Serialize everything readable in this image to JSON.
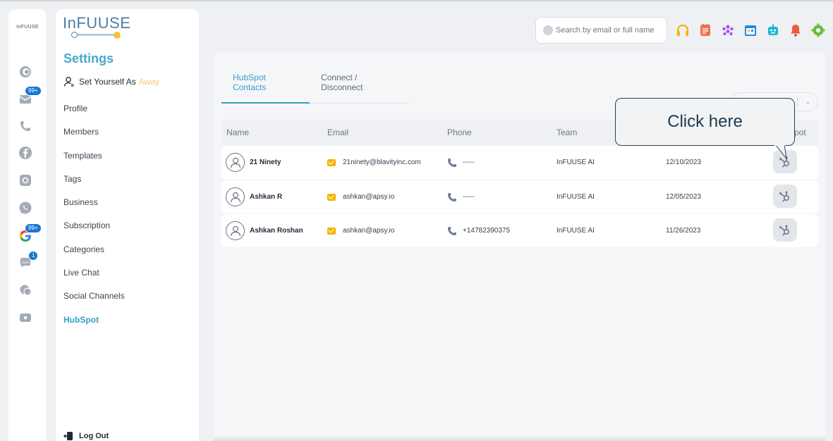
{
  "rail": {
    "logo": "InFUUSE",
    "logo_sub": "~~~",
    "badges": {
      "email": "99+",
      "google": "99+",
      "sms": "1"
    }
  },
  "settings": {
    "brand": "InFUUSE",
    "title": "Settings",
    "away_prefix": "Set Yourself As",
    "away_word": "Away",
    "menu": [
      "Profile",
      "Members",
      "Templates",
      "Tags",
      "Business",
      "Subscription",
      "Categories",
      "Live Chat",
      "Social Channels",
      "HubSpot"
    ],
    "logout": "Log Out"
  },
  "search": {
    "placeholder": "Search by email or full name"
  },
  "main": {
    "tabs": [
      {
        "label": "HubSpot Contacts"
      },
      {
        "label": "Connect / Disconnect"
      }
    ],
    "columns": [
      "Name",
      "Email",
      "Phone",
      "Team",
      "",
      "pot"
    ],
    "rows": [
      {
        "name": "21 Ninety",
        "email": "21ninety@blavityinc.com",
        "phone": "-----",
        "team": "InFUUSE AI",
        "date": "12/10/2023"
      },
      {
        "name": "Ashkan R",
        "email": "ashkan@apsy.io",
        "phone": "-----",
        "team": "InFUUSE AI",
        "date": "12/05/2023"
      },
      {
        "name": "Ashkan Roshan",
        "email": "ashkan@apsy.io",
        "phone": "+14782390375",
        "team": "InFUUSE AI",
        "date": "11/26/2023"
      }
    ]
  },
  "callout": {
    "text": "Click here"
  },
  "icons": {
    "top": [
      "headset-icon",
      "note-icon",
      "team-icon",
      "calendar-icon",
      "bot-icon",
      "bell-icon",
      "settings-icon"
    ],
    "colors": {
      "accent": "#3a9cc8",
      "headset": "#f5b400",
      "note": "#f07048",
      "team": "#a855f7",
      "calendar": "#1e88e5",
      "bot": "#14b8c9",
      "bell": "#f05a3c",
      "settings": "#6abf3a"
    }
  }
}
